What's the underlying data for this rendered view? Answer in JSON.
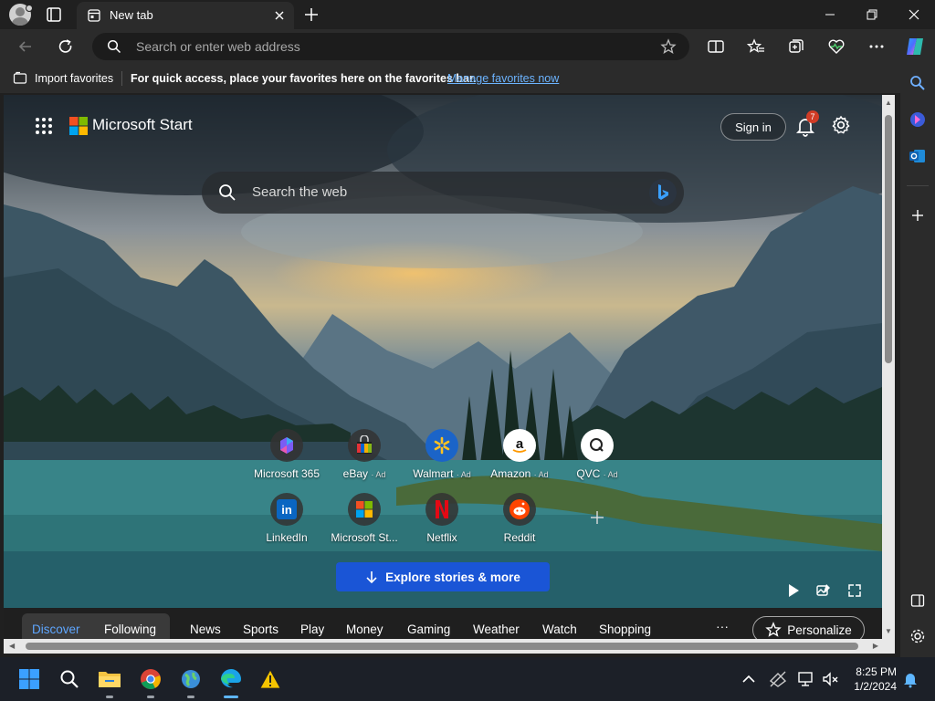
{
  "browser": {
    "tab_title": "New tab",
    "address_placeholder": "Search or enter web address"
  },
  "favorites_bar": {
    "import_label": "Import favorites",
    "message": "For quick access, place your favorites here on the favorites bar.",
    "manage_link": "Manage favorites now"
  },
  "start_page": {
    "brand": "Microsoft Start",
    "sign_in": "Sign in",
    "notification_count": "7",
    "search_placeholder": "Search the web",
    "explore_button": "Explore stories & more",
    "tiles": [
      {
        "label": "Microsoft 365",
        "ad": ""
      },
      {
        "label": "eBay",
        "ad": "· Ad"
      },
      {
        "label": "Walmart",
        "ad": "· Ad"
      },
      {
        "label": "Amazon",
        "ad": "· Ad"
      },
      {
        "label": "QVC",
        "ad": "· Ad"
      },
      {
        "label": "LinkedIn",
        "ad": ""
      },
      {
        "label": "Microsoft St...",
        "ad": ""
      },
      {
        "label": "Netflix",
        "ad": ""
      },
      {
        "label": "Reddit",
        "ad": ""
      }
    ],
    "nav": [
      "Discover",
      "Following",
      "News",
      "Sports",
      "Play",
      "Money",
      "Gaming",
      "Weather",
      "Watch",
      "Shopping"
    ],
    "nav_more": "···",
    "personalize": "Personalize"
  },
  "taskbar": {
    "time": "8:25 PM",
    "date": "1/2/2024"
  },
  "colors": {
    "accent_blue": "#1a55d6",
    "active_nav": "#5ea6ff",
    "badge_red": "#d13c26"
  }
}
